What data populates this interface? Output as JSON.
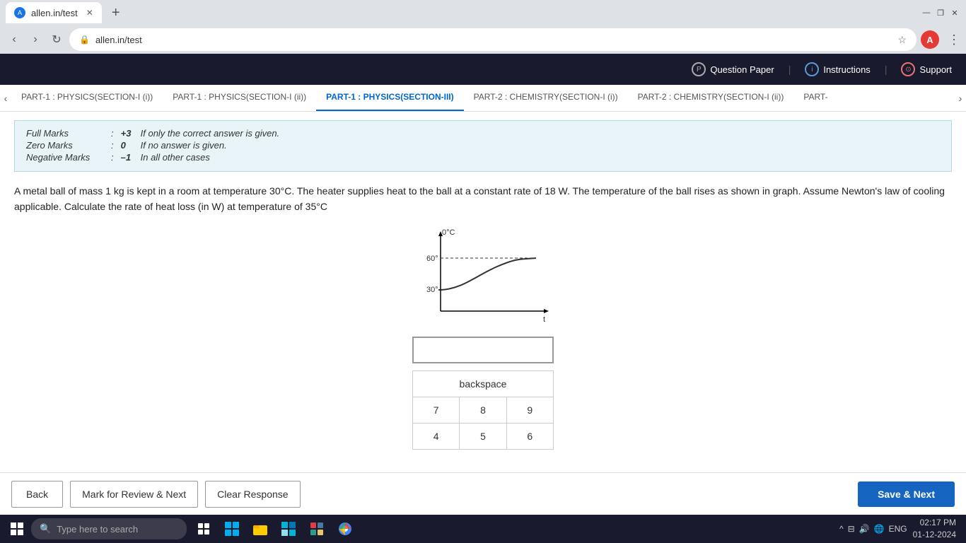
{
  "browser": {
    "url": "allen.in/test",
    "tab_title": "allen.in/test",
    "favicon_letter": "A"
  },
  "header": {
    "question_paper_label": "Question Paper",
    "instructions_label": "Instructions",
    "support_label": "Support"
  },
  "tabs": [
    {
      "id": "t1",
      "label": "PART-1 : PHYSICS(SECTION-I (i))",
      "active": false
    },
    {
      "id": "t2",
      "label": "PART-1 : PHYSICS(SECTION-I (ii))",
      "active": false
    },
    {
      "id": "t3",
      "label": "PART-1 : PHYSICS(SECTION-III)",
      "active": true
    },
    {
      "id": "t4",
      "label": "PART-2 : CHEMISTRY(SECTION-I (i))",
      "active": false
    },
    {
      "id": "t5",
      "label": "PART-2 : CHEMISTRY(SECTION-I (ii))",
      "active": false
    },
    {
      "id": "t6",
      "label": "PART-",
      "active": false
    }
  ],
  "marking_scheme": {
    "full_marks_label": "Full Marks",
    "full_marks_colon": ":",
    "full_marks_value": "+3",
    "full_marks_desc": "If only the correct answer is given.",
    "zero_marks_label": "Zero Marks",
    "zero_marks_colon": ":",
    "zero_marks_value": "0",
    "zero_marks_desc": "If no answer is given.",
    "negative_marks_label": "Negative Marks",
    "negative_marks_colon": ":",
    "negative_marks_value": "–1",
    "negative_marks_desc": "In all other cases"
  },
  "question": {
    "text": "A metal ball of mass 1 kg is kept in a room at temperature 30°C. The heater supplies heat to the ball at a constant rate of 18 W. The temperature of the ball rises as shown in graph. Assume Newton's law of cooling applicable. Calculate the rate of heat loss (in W) at temperature of 35°C"
  },
  "graph": {
    "y_axis_label": "0°C",
    "y_60": "60°",
    "y_30": "30°",
    "x_axis_label": "t"
  },
  "numpad": {
    "backspace_label": "backspace",
    "buttons": [
      [
        "7",
        "8",
        "9"
      ],
      [
        "4",
        "5",
        "6"
      ]
    ]
  },
  "actions": {
    "back_label": "Back",
    "mark_review_label": "Mark for Review & Next",
    "clear_response_label": "Clear Response",
    "save_next_label": "Save & Next"
  },
  "taskbar": {
    "search_placeholder": "Type here to search",
    "sys_icons": [
      "^",
      "■",
      "🔊",
      "wifi",
      "ENG"
    ],
    "time": "02:17 PM",
    "date": "01-12-2024",
    "lang": "ENG"
  }
}
